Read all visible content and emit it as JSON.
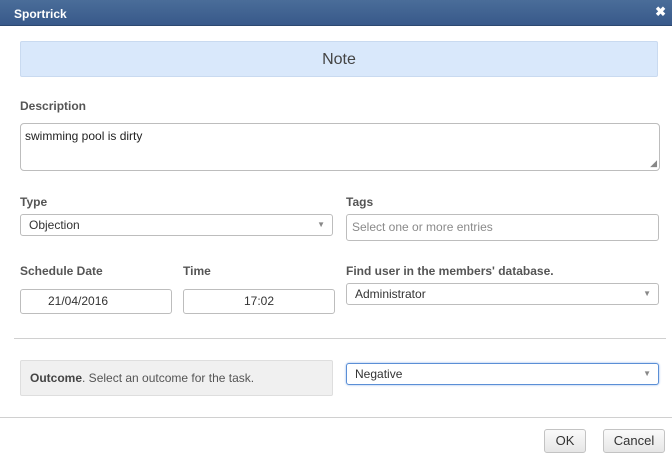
{
  "window": {
    "title": "Sportrick",
    "close_glyph": "✖"
  },
  "note_banner": {
    "title": "Note"
  },
  "description": {
    "label": "Description",
    "value": "swimming pool is dirty"
  },
  "type": {
    "label": "Type",
    "value": "Objection"
  },
  "tags": {
    "label": "Tags",
    "placeholder": "Select one or more entries"
  },
  "schedule": {
    "date_label": "Schedule Date",
    "date_value": "21/04/2016",
    "time_label": "Time",
    "time_value": "17:02"
  },
  "find_user": {
    "label": "Find user in the members' database.",
    "value": "Administrator"
  },
  "outcome": {
    "label_bold": "Outcome",
    "label_rest": ". Select an outcome for the task.",
    "value": "Negative"
  },
  "buttons": {
    "ok": "OK",
    "cancel": "Cancel"
  },
  "icons": {
    "dropdown": "chevron-down-icon",
    "close": "close-icon"
  },
  "colors": {
    "titlebar": "#3f6190",
    "banner": "#d9e8fb",
    "focus_border": "#5b8fd6"
  }
}
